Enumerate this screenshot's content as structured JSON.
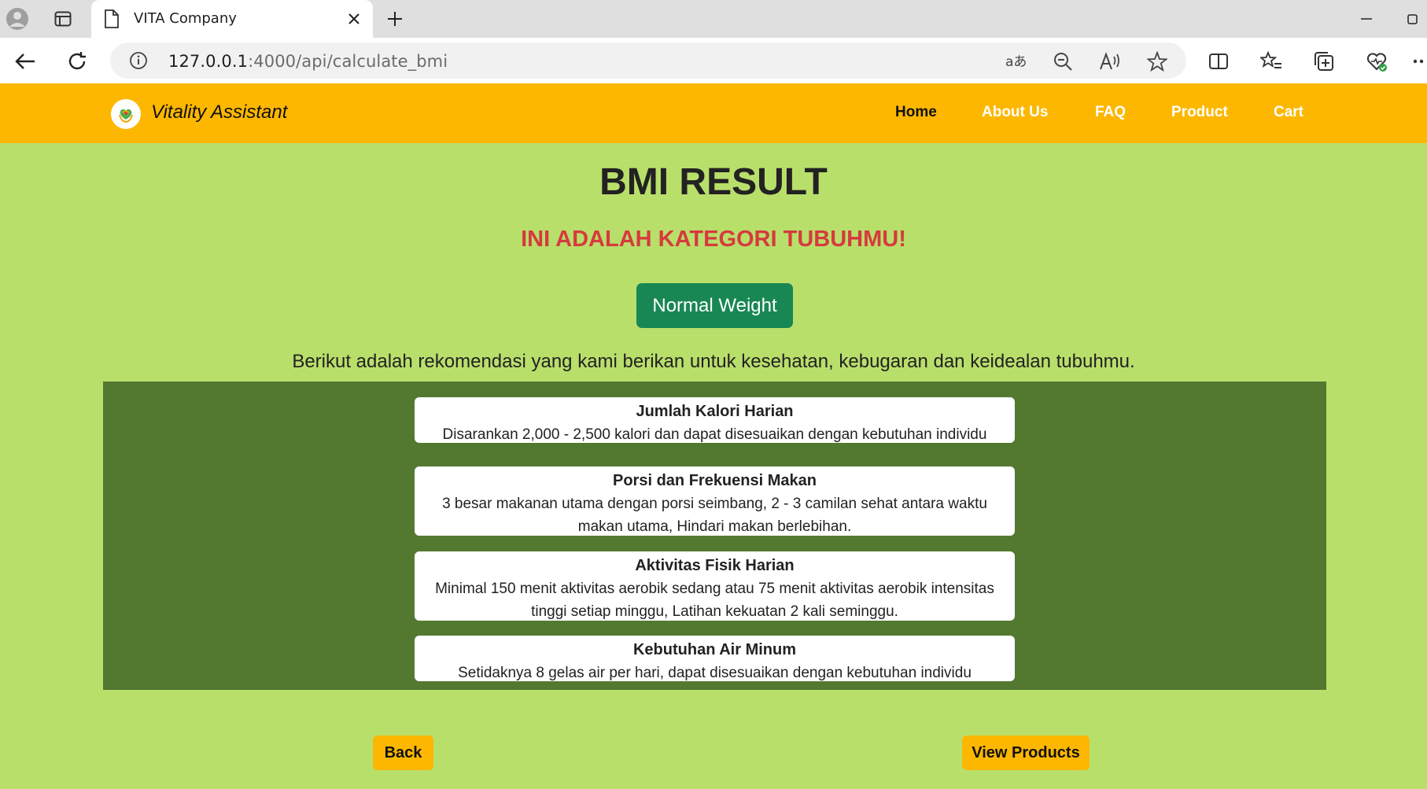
{
  "browser": {
    "tab_title": "VITA Company",
    "url_host": "127.0.0.1",
    "url_rest": ":4000/api/calculate_bmi"
  },
  "navbar": {
    "brand": "Vitality Assistant",
    "links": [
      "Home",
      "About Us",
      "FAQ",
      "Product",
      "Cart"
    ]
  },
  "result": {
    "title": "BMI RESULT",
    "subtitle": "INI ADALAH KATEGORI TUBUHMU!",
    "category": "Normal Weight",
    "intro": "Berikut adalah rekomendasi yang kami berikan untuk kesehatan, kebugaran dan keidealan tubuhmu."
  },
  "recommendations": [
    {
      "title": "Jumlah Kalori Harian",
      "text": "Disarankan 2,000 - 2,500 kalori dan dapat disesuaikan dengan kebutuhan individu"
    },
    {
      "title": "Porsi dan Frekuensi Makan",
      "text": "3 besar makanan utama dengan porsi seimbang, 2 - 3 camilan sehat antara waktu makan utama, Hindari makan berlebihan."
    },
    {
      "title": "Aktivitas Fisik Harian",
      "text": "Minimal 150 menit aktivitas aerobik sedang atau 75 menit aktivitas aerobik intensitas tinggi setiap minggu, Latihan kekuatan 2 kali seminggu."
    },
    {
      "title": "Kebutuhan Air Minum",
      "text": "Setidaknya 8 gelas air per hari, dapat disesuaikan dengan kebutuhan individu"
    }
  ],
  "actions": {
    "back": "Back",
    "view_products": "View Products"
  },
  "colors": {
    "navbar": "#fdb700",
    "page_bg": "#b9df6b",
    "panel_bg": "#537830",
    "badge": "#198754",
    "subtitle": "#d63a3e"
  }
}
